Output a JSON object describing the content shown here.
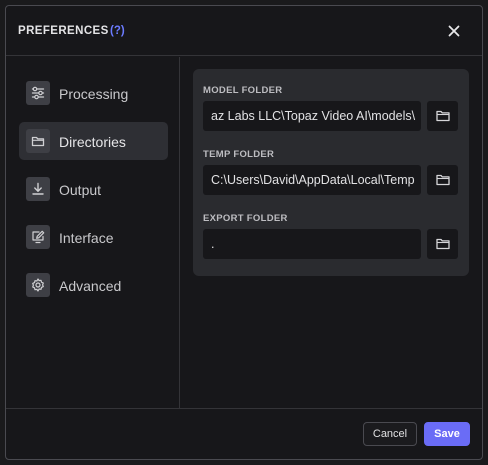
{
  "dialog": {
    "title": "PREFERENCES",
    "help": "(?)"
  },
  "sidebar": {
    "items": [
      {
        "label": "Processing",
        "icon": "sliders-icon",
        "active": false
      },
      {
        "label": "Directories",
        "icon": "folder-icon",
        "active": true
      },
      {
        "label": "Output",
        "icon": "download-icon",
        "active": false
      },
      {
        "label": "Interface",
        "icon": "edit-screen-icon",
        "active": false
      },
      {
        "label": "Advanced",
        "icon": "gear-icon",
        "active": false
      }
    ]
  },
  "fields": {
    "model_folder": {
      "label": "MODEL FOLDER",
      "value": "az Labs LLC\\Topaz Video AI\\models\\"
    },
    "temp_folder": {
      "label": "TEMP FOLDER",
      "value": "C:\\Users\\David\\AppData\\Local\\Temp"
    },
    "export_folder": {
      "label": "EXPORT FOLDER",
      "value": "."
    }
  },
  "footer": {
    "cancel_label": "Cancel",
    "save_label": "Save"
  },
  "colors": {
    "accent": "#6a6cf6",
    "help_link": "#6b7bff",
    "background": "#17171a",
    "panel": "#2a2b2f"
  }
}
